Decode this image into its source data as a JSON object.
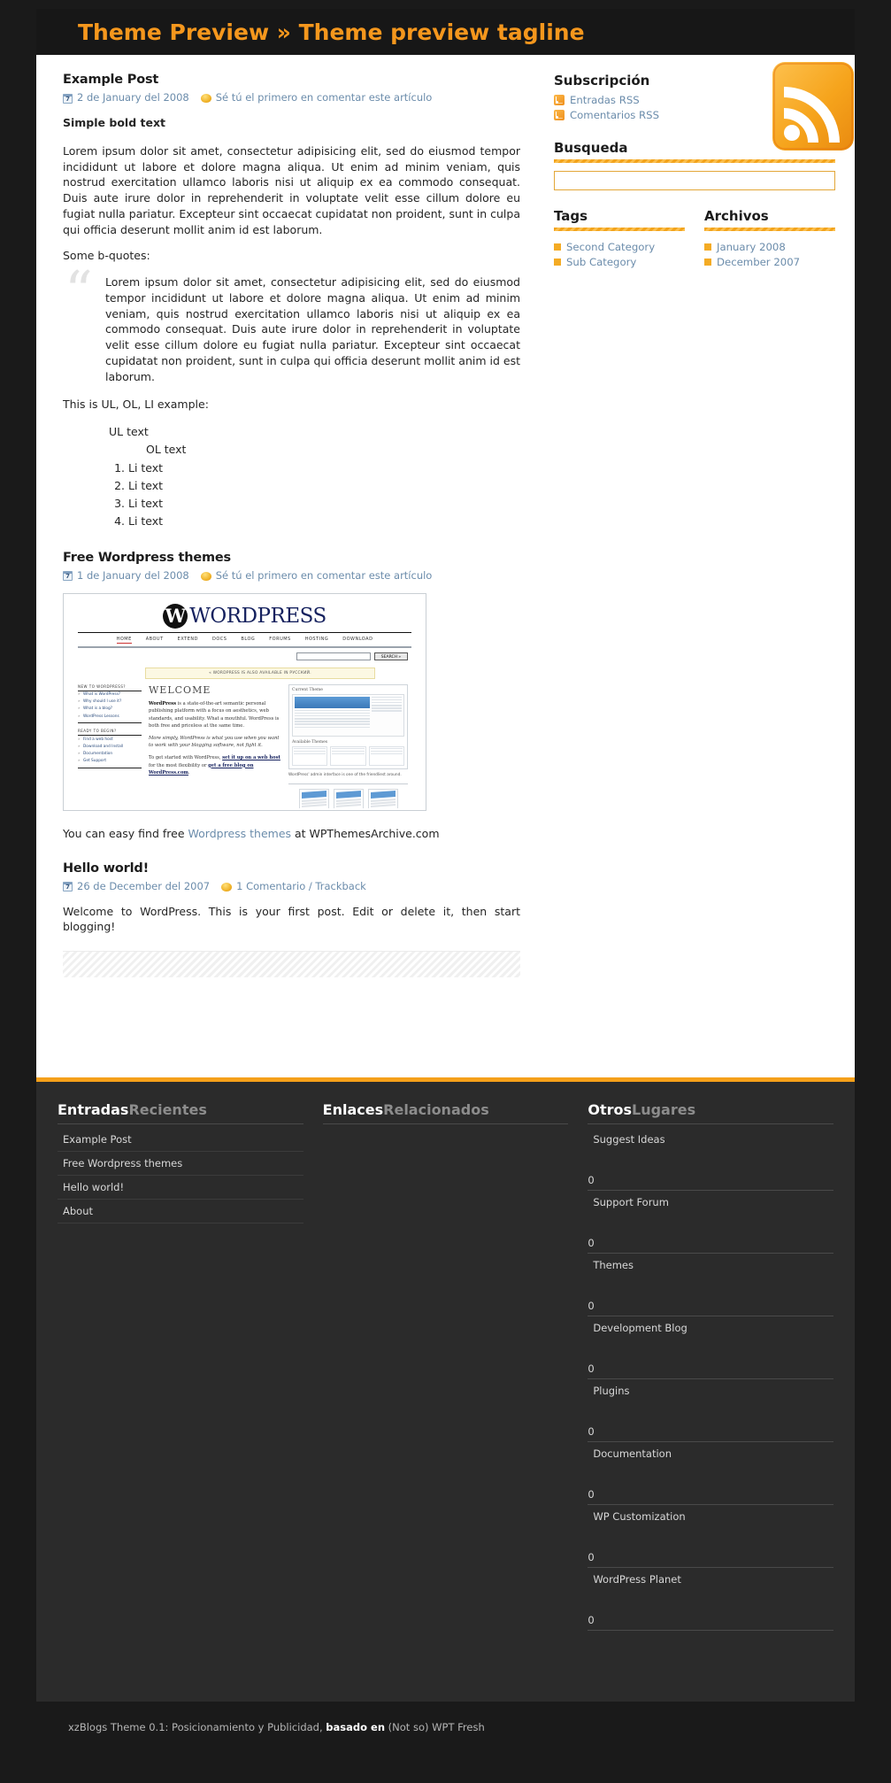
{
  "header": {
    "title": "Theme Preview » Theme preview tagline"
  },
  "posts": [
    {
      "title": "Example Post",
      "date": "2 de January del 2008",
      "comments": "Sé tú el primero en comentar este artículo",
      "lead": "Simple bold text",
      "body": "Lorem ipsum dolor sit amet, consectetur adipisicing elit, sed do eiusmod tempor incididunt ut labore et dolore magna aliqua. Ut enim ad minim veniam, quis nostrud exercitation ullamco laboris nisi ut aliquip ex ea commodo consequat. Duis aute irure dolor in reprehenderit in voluptate velit esse cillum dolore eu fugiat nulla pariatur. Excepteur sint occaecat cupidatat non proident, sunt in culpa qui officia deserunt mollit anim id est laborum.",
      "quote_intro": "Some b-quotes:",
      "quote": "Lorem ipsum dolor sit amet, consectetur adipisicing elit, sed do eiusmod tempor incididunt ut labore et dolore magna aliqua. Ut enim ad minim veniam, quis nostrud exercitation ullamco laboris nisi ut aliquip ex ea commodo consequat. Duis aute irure dolor in reprehenderit in voluptate velit esse cillum dolore eu fugiat nulla pariatur. Excepteur sint occaecat cupidatat non proident, sunt in culpa qui officia deserunt mollit anim id est laborum.",
      "list_intro": "This is UL, OL, LI example:",
      "ul_text": "UL text",
      "ol_text": "OL text",
      "li_items": [
        "Li text",
        "Li text",
        "Li text",
        "Li text"
      ]
    },
    {
      "title": "Free Wordpress themes",
      "date": "1 de January del 2008",
      "comments": "Sé tú el primero en comentar este artículo",
      "tail_pre": "You can easy find free ",
      "tail_link": "Wordpress themes",
      "tail_post": " at WPThemesArchive.com"
    },
    {
      "title": "Hello world!",
      "date": "26 de December del 2007",
      "comments": "1 Comentario / Trackback",
      "body": "Welcome to WordPress. This is your first post. Edit or delete it, then start blogging!"
    }
  ],
  "screenshot": {
    "brand": "WORDPRESS",
    "brand_mark": "W",
    "nav": [
      "HOME",
      "ABOUT",
      "EXTEND",
      "DOCS",
      "BLOG",
      "FORUMS",
      "HOSTING",
      "DOWNLOAD"
    ],
    "search_button": "SEARCH »",
    "notice": "« WORDPRESS IS ALSO AVAILABLE IN РУССКИЙ.",
    "left_head_1": "NEW TO WORDPRESS?",
    "left_links_1": [
      "What is WordPress?",
      "Why should I use it?",
      "What is a blog?",
      "WordPress Lessons"
    ],
    "left_head_2": "READY TO BEGIN?",
    "left_links_2": [
      "Find a web host",
      "Download and Install",
      "Documentation",
      "Get Support"
    ],
    "welcome": "WELCOME",
    "para1_bold": "WordPress",
    "para1": " is a state-of-the-art semantic personal publishing platform with a focus on aesthetics, web standards, and usability. What a mouthful. WordPress is both free and priceless at the same time.",
    "para2": "More simply, WordPress is what you use when you want to work with your blogging software, not fight it.",
    "para3_a": "To get started with WordPress, ",
    "para3_link1": "set it up on a web host",
    "para3_b": " for the most flexibility or ",
    "para3_link2": "get a free blog on WordPress.com",
    "para3_c": ".",
    "panel_title": "Current Theme",
    "panel_avail": "Available Themes",
    "caption": "WordPress' admin interface is one of the friendliest around."
  },
  "sidebar": {
    "subscription": {
      "heading": "Subscripción",
      "items": [
        "Entradas RSS",
        "Comentarios RSS"
      ]
    },
    "search": {
      "heading": "Busqueda",
      "value": "",
      "placeholder": ""
    },
    "tags": {
      "heading": "Tags",
      "items": [
        "Second Category",
        "Sub Category"
      ]
    },
    "archivos": {
      "heading": "Archivos",
      "items": [
        "January 2008",
        "December 2007"
      ]
    }
  },
  "footer": {
    "col1": {
      "heading_a": "Entradas",
      "heading_b": "Recientes",
      "items": [
        "Example Post",
        "Free Wordpress themes",
        "Hello world!",
        "About"
      ]
    },
    "col2": {
      "heading_a": "Enlaces",
      "heading_b": "Relacionados",
      "items": []
    },
    "col3": {
      "heading_a": "Otros",
      "heading_b": "Lugares",
      "items": [
        {
          "name": "Suggest Ideas",
          "count": "0"
        },
        {
          "name": "Support Forum",
          "count": "0"
        },
        {
          "name": "Themes",
          "count": "0"
        },
        {
          "name": "Development Blog",
          "count": "0"
        },
        {
          "name": "Plugins",
          "count": "0"
        },
        {
          "name": "Documentation",
          "count": "0"
        },
        {
          "name": "WP Customization",
          "count": "0"
        },
        {
          "name": "WordPress Planet",
          "count": "0"
        }
      ]
    }
  },
  "copyright": {
    "pre": "xzBlogs Theme 0.1: Posicionamiento y Publicidad, ",
    "bold": "basado en",
    "post": " (Not so) WPT Fresh"
  },
  "colors": {
    "accent": "#f5971d",
    "rule": "#f2a31c",
    "link": "#6b8cab",
    "dark": "#1a1a1a",
    "footer_bg": "#2b2b2b"
  }
}
